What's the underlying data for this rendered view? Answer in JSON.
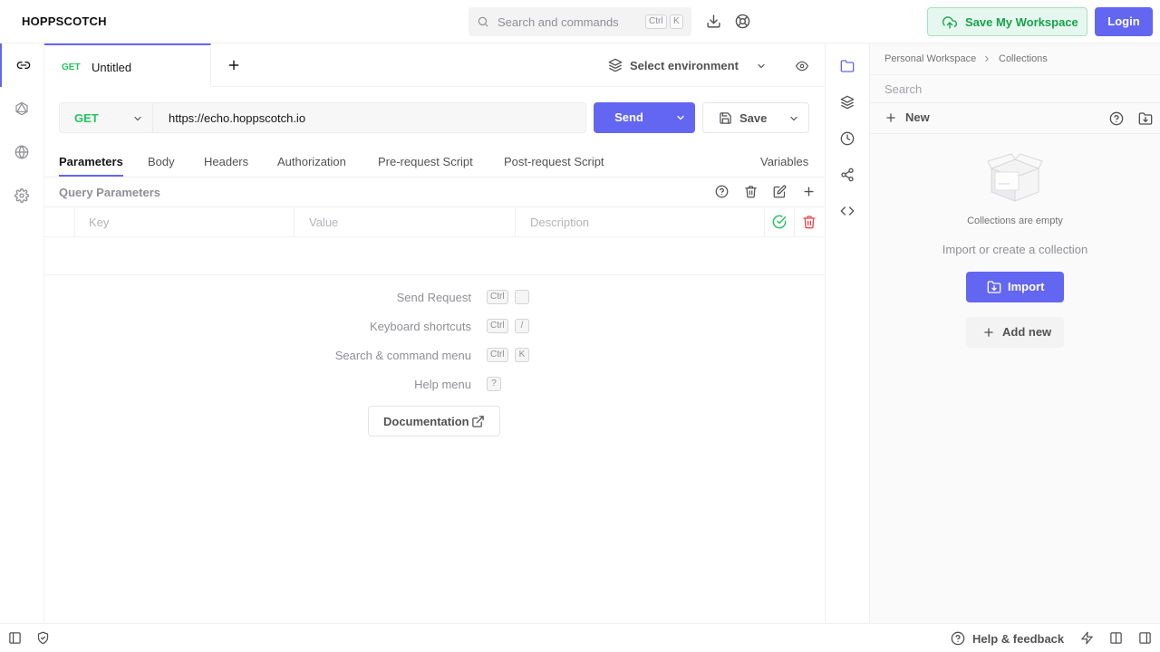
{
  "app": {
    "brand": "HOPPSCOTCH"
  },
  "header": {
    "search_placeholder": "Search and commands",
    "search_kbd": [
      "Ctrl",
      "K"
    ],
    "save_workspace_label": "Save My Workspace",
    "login_label": "Login",
    "accent_color": "#6366f1",
    "success_color": "#16a34a"
  },
  "tabs": [
    {
      "method": "GET",
      "name": "Untitled",
      "active": true
    }
  ],
  "environment": {
    "label": "Select environment"
  },
  "request": {
    "method": "GET",
    "url": "https://echo.hoppscotch.io",
    "send_label": "Send",
    "save_label": "Save"
  },
  "subtabs": [
    "Parameters",
    "Body",
    "Headers",
    "Authorization",
    "Pre-request Script",
    "Post-request Script"
  ],
  "variables_label": "Variables",
  "query_params": {
    "title": "Query Parameters",
    "columns": {
      "key": "Key",
      "value": "Value",
      "description": "Description"
    }
  },
  "shortcuts": [
    {
      "label": "Send Request",
      "keys": [
        "Ctrl",
        ""
      ]
    },
    {
      "label": "Keyboard shortcuts",
      "keys": [
        "Ctrl",
        "/"
      ]
    },
    {
      "label": "Search & command menu",
      "keys": [
        "Ctrl",
        "K"
      ]
    },
    {
      "label": "Help menu",
      "keys": [
        "?"
      ]
    }
  ],
  "documentation_label": "Documentation",
  "collections": {
    "breadcrumb": [
      "Personal Workspace",
      "Collections"
    ],
    "search_placeholder": "Search",
    "new_label": "New",
    "empty_title": "Collections are empty",
    "empty_subtitle": "Import or create a collection",
    "import_label": "Import",
    "add_new_label": "Add new"
  },
  "footer": {
    "help_label": "Help & feedback"
  }
}
